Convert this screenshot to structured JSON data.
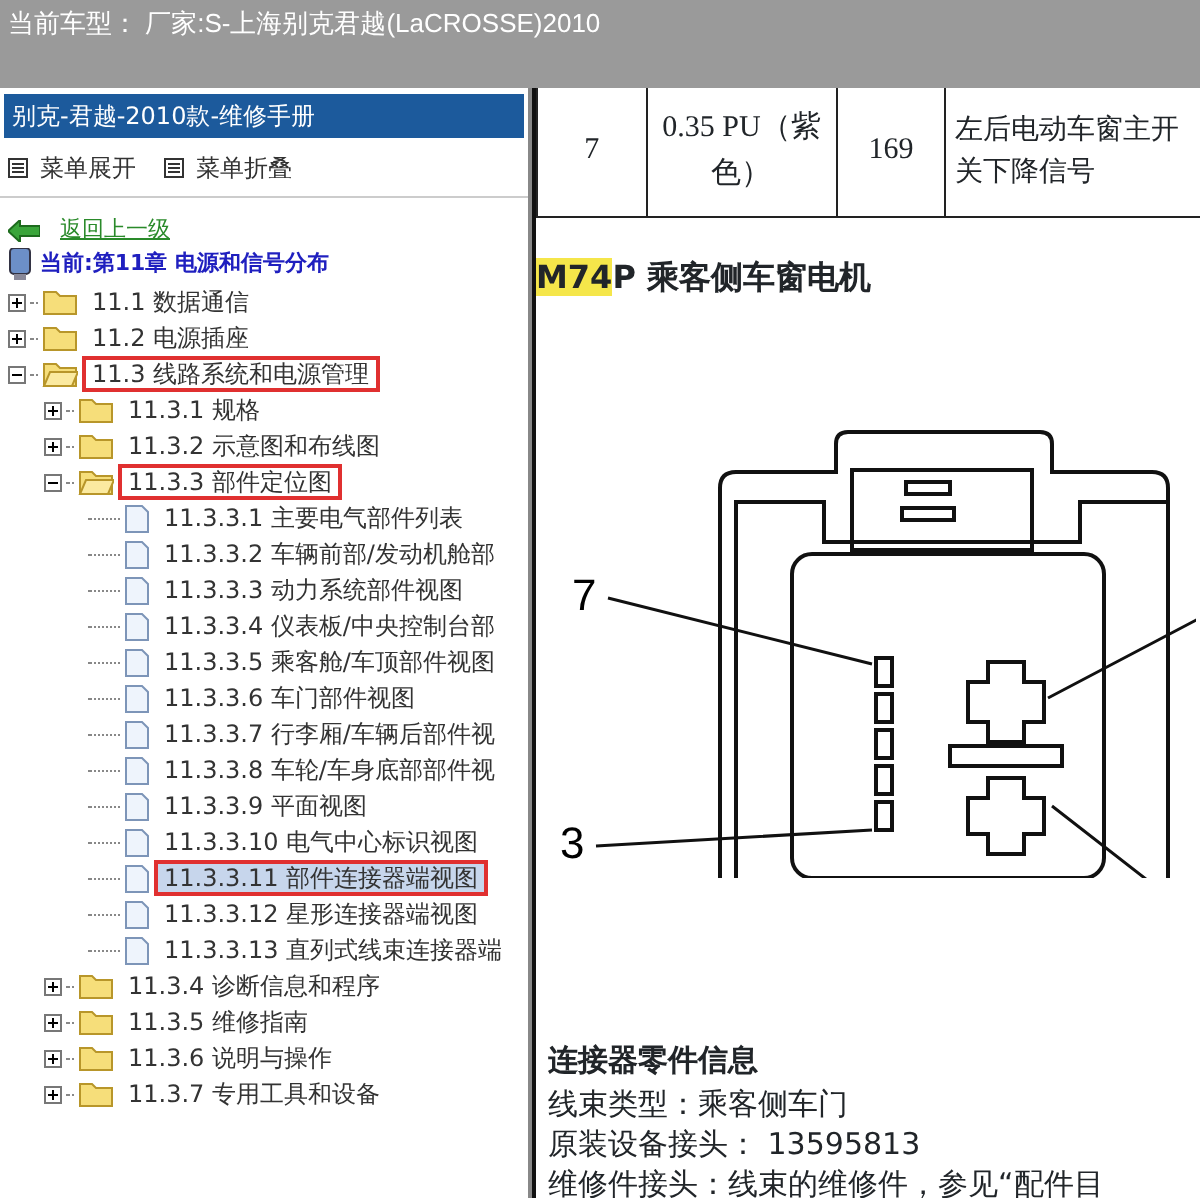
{
  "window": {
    "title": "当前车型： 厂家:S-上海别克君越(LaCROSSE)2010"
  },
  "sidebar": {
    "title": "别克-君越-2010款-维修手册",
    "toolbar": [
      "菜单展开",
      "菜单折叠"
    ],
    "back_link": "返回上一级",
    "current": "当前:第11章 电源和信号分布",
    "tree": [
      {
        "kind": "folder",
        "label": "11.1 数据通信",
        "expanded": false,
        "selected": false,
        "highlighted": false
      },
      {
        "kind": "folder",
        "label": "11.2 电源插座",
        "expanded": false,
        "selected": false,
        "highlighted": false
      },
      {
        "kind": "folder",
        "label": "11.3 线路系统和电源管理",
        "expanded": true,
        "selected": false,
        "highlighted": true,
        "children": [
          {
            "kind": "folder",
            "label": "11.3.1 规格",
            "expanded": false,
            "selected": false,
            "highlighted": false
          },
          {
            "kind": "folder",
            "label": "11.3.2 示意图和布线图",
            "expanded": false,
            "selected": false,
            "highlighted": false
          },
          {
            "kind": "folder",
            "label": "11.3.3 部件定位图",
            "expanded": true,
            "selected": false,
            "highlighted": true,
            "children": [
              {
                "kind": "page",
                "label": "11.3.3.1 主要电气部件列表",
                "selected": false,
                "highlighted": false
              },
              {
                "kind": "page",
                "label": "11.3.3.2 车辆前部/发动机舱部",
                "selected": false,
                "highlighted": false
              },
              {
                "kind": "page",
                "label": "11.3.3.3 动力系统部件视图",
                "selected": false,
                "highlighted": false
              },
              {
                "kind": "page",
                "label": "11.3.3.4 仪表板/中央控制台部",
                "selected": false,
                "highlighted": false
              },
              {
                "kind": "page",
                "label": "11.3.3.5 乘客舱/车顶部件视图",
                "selected": false,
                "highlighted": false
              },
              {
                "kind": "page",
                "label": "11.3.3.6 车门部件视图",
                "selected": false,
                "highlighted": false
              },
              {
                "kind": "page",
                "label": "11.3.3.7 行李厢/车辆后部件视",
                "selected": false,
                "highlighted": false
              },
              {
                "kind": "page",
                "label": "11.3.3.8 车轮/车身底部部件视",
                "selected": false,
                "highlighted": false
              },
              {
                "kind": "page",
                "label": "11.3.3.9 平面视图",
                "selected": false,
                "highlighted": false
              },
              {
                "kind": "page",
                "label": "11.3.3.10 电气中心标识视图",
                "selected": false,
                "highlighted": false
              },
              {
                "kind": "page",
                "label": "11.3.3.11 部件连接器端视图",
                "selected": true,
                "highlighted": true
              },
              {
                "kind": "page",
                "label": "11.3.3.12 星形连接器端视图",
                "selected": false,
                "highlighted": false
              },
              {
                "kind": "page",
                "label": "11.3.3.13 直列式线束连接器端",
                "selected": false,
                "highlighted": false
              }
            ]
          },
          {
            "kind": "folder",
            "label": "11.3.4 诊断信息和程序",
            "expanded": false,
            "selected": false,
            "highlighted": false
          },
          {
            "kind": "folder",
            "label": "11.3.5 维修指南",
            "expanded": false,
            "selected": false,
            "highlighted": false
          },
          {
            "kind": "folder",
            "label": "11.3.6 说明与操作",
            "expanded": false,
            "selected": false,
            "highlighted": false
          },
          {
            "kind": "folder",
            "label": "11.3.7 专用工具和设备",
            "expanded": false,
            "selected": false,
            "highlighted": false
          }
        ]
      }
    ]
  },
  "content": {
    "table": {
      "rows": [
        [
          "7",
          "0.35 PU（紫色）",
          "169",
          "左后电动车窗主开关下降信号"
        ]
      ]
    },
    "heading": {
      "code": "M74",
      "suffix": "P 乘客侧车窗电机"
    },
    "diagram": {
      "labels": [
        "7",
        "3"
      ]
    },
    "info_title": "连接器零件信息",
    "info_lines": [
      "线束类型：乘客侧车门",
      "原装设备接头： 13595813",
      "维修件接头：线束的维修件，参见“配件目"
    ]
  }
}
